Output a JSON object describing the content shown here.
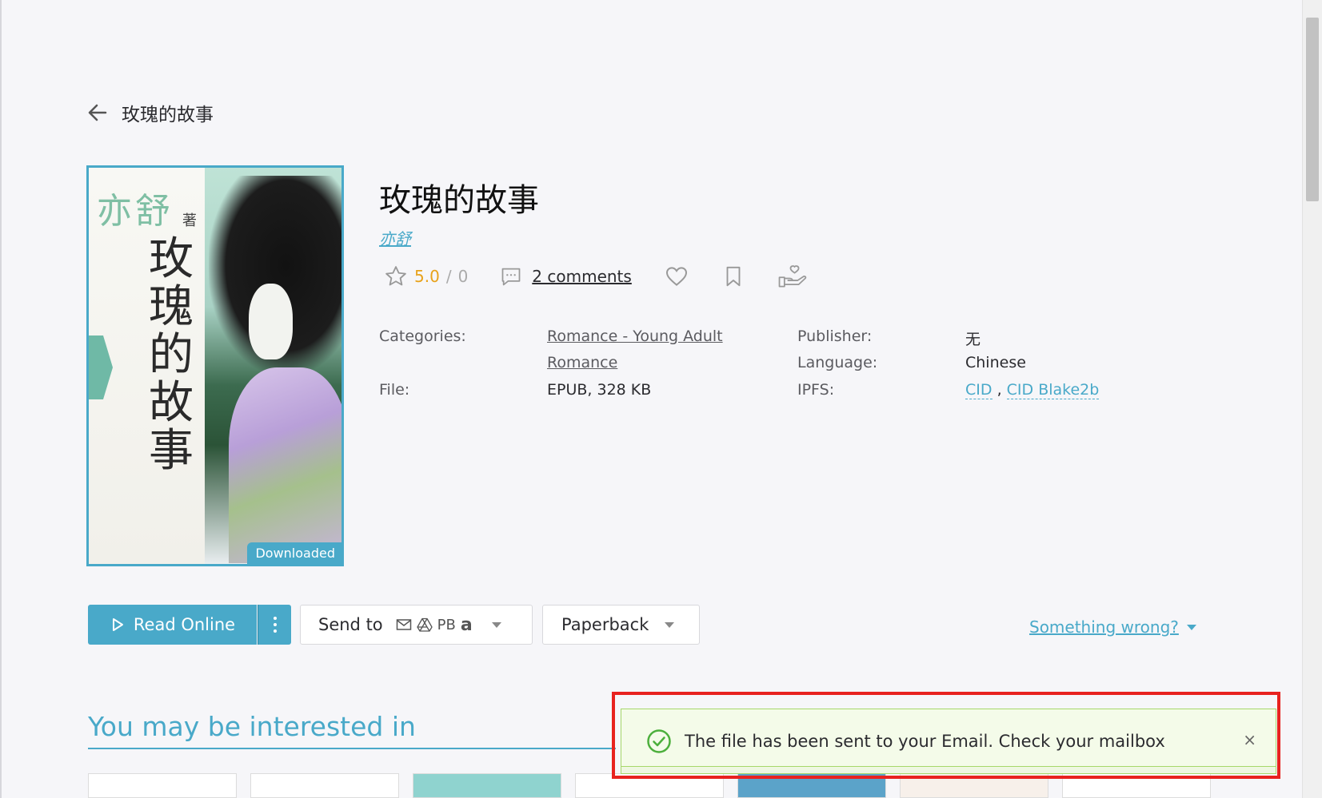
{
  "header": {
    "back_title": "玫瑰的故事"
  },
  "cover": {
    "author_text": "亦舒",
    "by_text": "著",
    "title_text": "玫瑰的故事",
    "badge": "Downloaded"
  },
  "book": {
    "title": "玫瑰的故事",
    "author": "亦舒",
    "rating": "5.0",
    "rating_sep": "/",
    "rating_count": "0",
    "comments": "2 comments"
  },
  "details": {
    "categories_label": "Categories:",
    "categories_line1": "Romance - Young Adult",
    "categories_line2": "Romance",
    "file_label": "File:",
    "file_value": "EPUB, 328 KB",
    "publisher_label": "Publisher:",
    "publisher_value": "无",
    "language_label": "Language:",
    "language_value": "Chinese",
    "ipfs_label": "IPFS:",
    "ipfs_cid": "CID",
    "ipfs_sep": ",",
    "ipfs_blake": "CID Blake2b"
  },
  "actions": {
    "read_online": "Read Online",
    "send_to": "Send to",
    "send_pb": "PB",
    "send_amazon": "a",
    "paperback": "Paperback",
    "something_wrong": "Something wrong?"
  },
  "section": {
    "interested": "You may be interested in"
  },
  "toast": {
    "message": "The file has been sent to your Email. Check your mailbox",
    "close": "×"
  },
  "colors": {
    "accent": "#49a9c9",
    "rating": "#e8a21b",
    "toast_bg": "#f4fbe9",
    "toast_border": "#a6d76a",
    "highlight": "#e8221f"
  }
}
